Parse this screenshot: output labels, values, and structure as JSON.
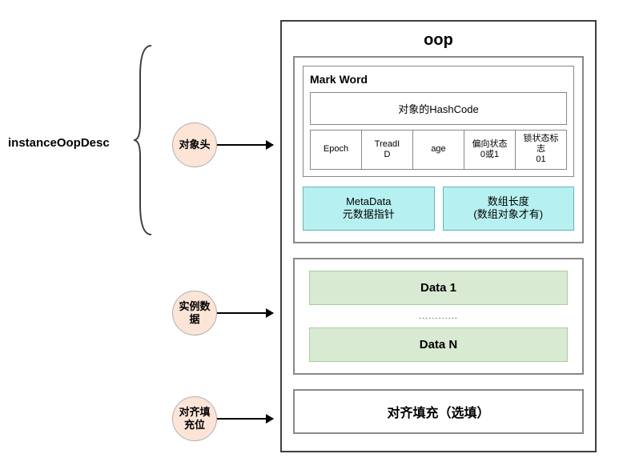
{
  "leftLabel": "instanceOopDesc",
  "circles": {
    "header": "对象头",
    "data": "实例数\n据",
    "padding": "对齐填\n充位"
  },
  "oopTitle": "oop",
  "markWord": {
    "title": "Mark Word",
    "hashcode": "对象的HashCode",
    "cells": [
      "Epoch",
      "TreadI\nD",
      "age",
      "偏向状态\n0或1",
      "锁状态标\n志\n01"
    ]
  },
  "metaRow": {
    "meta": "MetaData\n元数据指针",
    "arrayLen": "数组长度\n(数组对象才有)"
  },
  "dataSection": {
    "first": "Data 1",
    "dots": "............",
    "last": "Data N"
  },
  "paddingLabel": "对齐填充（选填）"
}
